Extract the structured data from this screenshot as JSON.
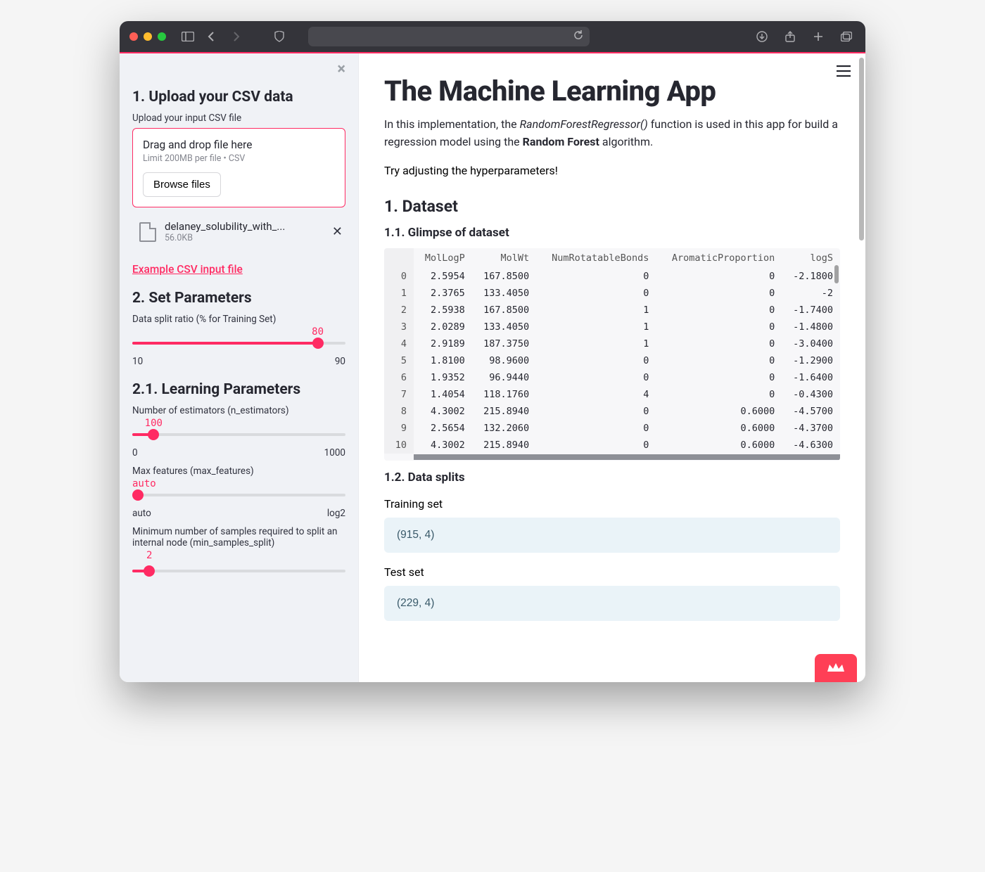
{
  "sidebar": {
    "upload_header": "1. Upload your CSV data",
    "upload_caption": "Upload your input CSV file",
    "dropzone_title": "Drag and drop file here",
    "dropzone_sub": "Limit 200MB per file • CSV",
    "browse_label": "Browse files",
    "file_name": "delaney_solubility_with_...",
    "file_size": "56.0KB",
    "example_link": "Example CSV input file",
    "params_header": "2. Set Parameters",
    "learning_header": "2.1. Learning Parameters",
    "sliders": {
      "split": {
        "label": "Data split ratio (% for Training Set)",
        "value": "80",
        "min": "10",
        "max": "90",
        "pct": 87
      },
      "n_estimators": {
        "label": "Number of estimators (n_estimators)",
        "value": "100",
        "min": "0",
        "max": "1000",
        "pct": 10
      },
      "max_features": {
        "label": "Max features (max_features)",
        "value": "auto",
        "min": "auto",
        "max": "log2",
        "pct": 0
      },
      "min_split": {
        "label": "Minimum number of samples required to split an internal node (min_samples_split)",
        "value": "2",
        "min": "",
        "max": "",
        "pct": 8
      }
    }
  },
  "main": {
    "title": "The Machine Learning App",
    "intro_pre": "In this implementation, the ",
    "intro_func": "RandomForestRegressor()",
    "intro_mid": " function is used in this app for build a regression model using the ",
    "intro_bold": "Random Forest",
    "intro_post": " algorithm.",
    "try_line": "Try adjusting the hyperparameters!",
    "dataset_header": "1. Dataset",
    "glimpse_header": "1.1. Glimpse of dataset",
    "splits_header": "1.2. Data splits",
    "train_label": "Training set",
    "train_shape": "(915, 4)",
    "test_label": "Test set",
    "test_shape": "(229, 4)",
    "columns": [
      "MolLogP",
      "MolWt",
      "NumRotatableBonds",
      "AromaticProportion",
      "logS"
    ],
    "rows": [
      [
        "0",
        "2.5954",
        "167.8500",
        "0",
        "0",
        "-2.1800"
      ],
      [
        "1",
        "2.3765",
        "133.4050",
        "0",
        "0",
        "-2"
      ],
      [
        "2",
        "2.5938",
        "167.8500",
        "1",
        "0",
        "-1.7400"
      ],
      [
        "3",
        "2.0289",
        "133.4050",
        "1",
        "0",
        "-1.4800"
      ],
      [
        "4",
        "2.9189",
        "187.3750",
        "1",
        "0",
        "-3.0400"
      ],
      [
        "5",
        "1.8100",
        "98.9600",
        "0",
        "0",
        "-1.2900"
      ],
      [
        "6",
        "1.9352",
        "96.9440",
        "0",
        "0",
        "-1.6400"
      ],
      [
        "7",
        "1.4054",
        "118.1760",
        "4",
        "0",
        "-0.4300"
      ],
      [
        "8",
        "4.3002",
        "215.8940",
        "0",
        "0.6000",
        "-4.5700"
      ],
      [
        "9",
        "2.5654",
        "132.2060",
        "0",
        "0.6000",
        "-4.3700"
      ],
      [
        "10",
        "4.3002",
        "215.8940",
        "0",
        "0.6000",
        "-4.6300"
      ]
    ]
  }
}
